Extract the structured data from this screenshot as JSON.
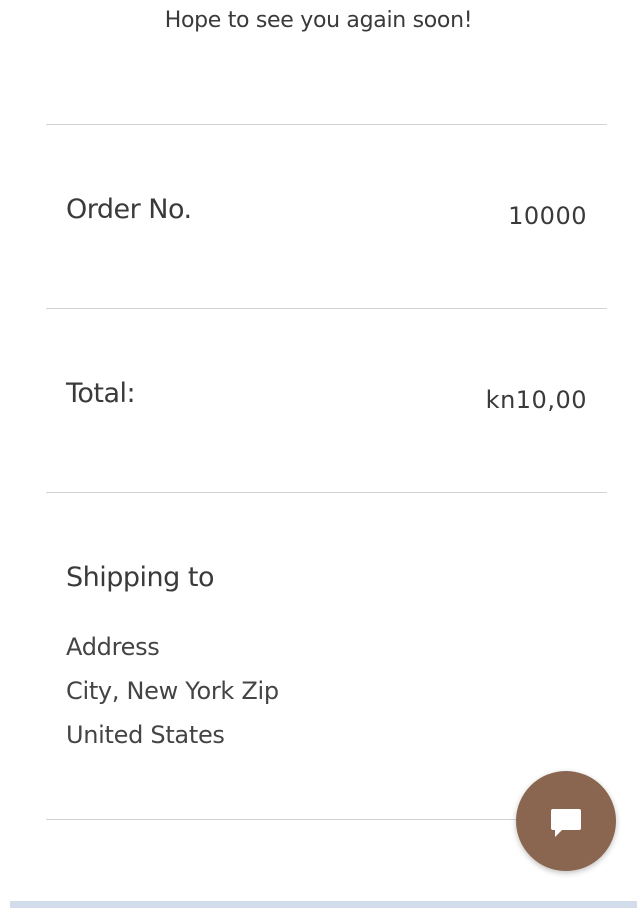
{
  "message": "Hope to see you again soon!",
  "order": {
    "label": "Order No.",
    "value": "10000"
  },
  "total": {
    "label": "Total:",
    "value": "kn10,00"
  },
  "shipping": {
    "label": "Shipping to",
    "lines": [
      "Address",
      "City, New York Zip",
      "United States"
    ]
  },
  "chat": {
    "icon": "chat-bubble-icon",
    "color": "#8a6650"
  }
}
